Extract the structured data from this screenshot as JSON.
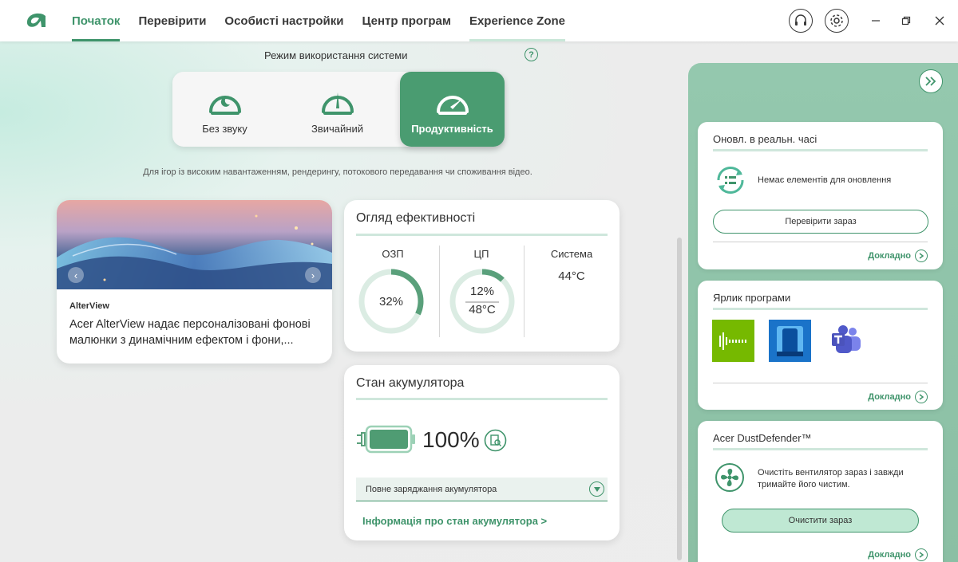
{
  "nav": {
    "items": [
      {
        "label": "Початок",
        "active": true
      },
      {
        "label": "Перевірити",
        "active": false
      },
      {
        "label": "Особисті настройки",
        "active": false
      },
      {
        "label": "Центр програм",
        "active": false
      },
      {
        "label": "Experience Zone",
        "active": false
      }
    ]
  },
  "usage_mode": {
    "title": "Режим використання системи",
    "help": "?",
    "options": [
      {
        "label": "Без звуку",
        "icon": "silent-mode-icon"
      },
      {
        "label": "Звичайний",
        "icon": "normal-mode-icon"
      },
      {
        "label": "Продуктивність",
        "icon": "performance-mode-icon",
        "active": true
      }
    ],
    "description": "Для ігор із високим навантаженням, рендерингу, потокового передавання чи споживання відео."
  },
  "alterview": {
    "tag": "AlterView",
    "text": "Acer AlterView надає персоналізовані фонові малюнки з динамічним ефектом і фони,...",
    "prev": "‹",
    "next": "›"
  },
  "performance": {
    "title": "Огляд ефективності",
    "ram_label": "ОЗП",
    "ram_value": "32%",
    "ram_fraction": 0.32,
    "cpu_label": "ЦП",
    "cpu_usage": "12%",
    "cpu_fraction": 0.12,
    "cpu_temp": "48°C",
    "system_label": "Система",
    "system_temp": "44°C"
  },
  "battery": {
    "title": "Стан акумулятора",
    "percent": "100%",
    "level": 1.0,
    "mode": "Повне заряджання акумулятора",
    "link": "Інформація про стан акумулятора >"
  },
  "side": {
    "updates": {
      "title": "Оновл. в реальн. часі",
      "message": "Немає елементів для оновлення",
      "button": "Перевірити зараз",
      "more": "Докладно"
    },
    "shortcuts": {
      "title": "Ярлик програми",
      "apps": [
        "audio-app-icon",
        "phone-app-icon",
        "teams-app-icon"
      ],
      "more": "Докладно"
    },
    "dust": {
      "title": "Acer DustDefender™",
      "message": "Очистіть вентилятор зараз і завжди тримайте його чистим.",
      "button": "Очистити зараз",
      "more": "Докладно"
    }
  },
  "colors": {
    "accent": "#3f946b",
    "accent_light": "#cfe7dc",
    "panel": "#8fc4aa"
  }
}
